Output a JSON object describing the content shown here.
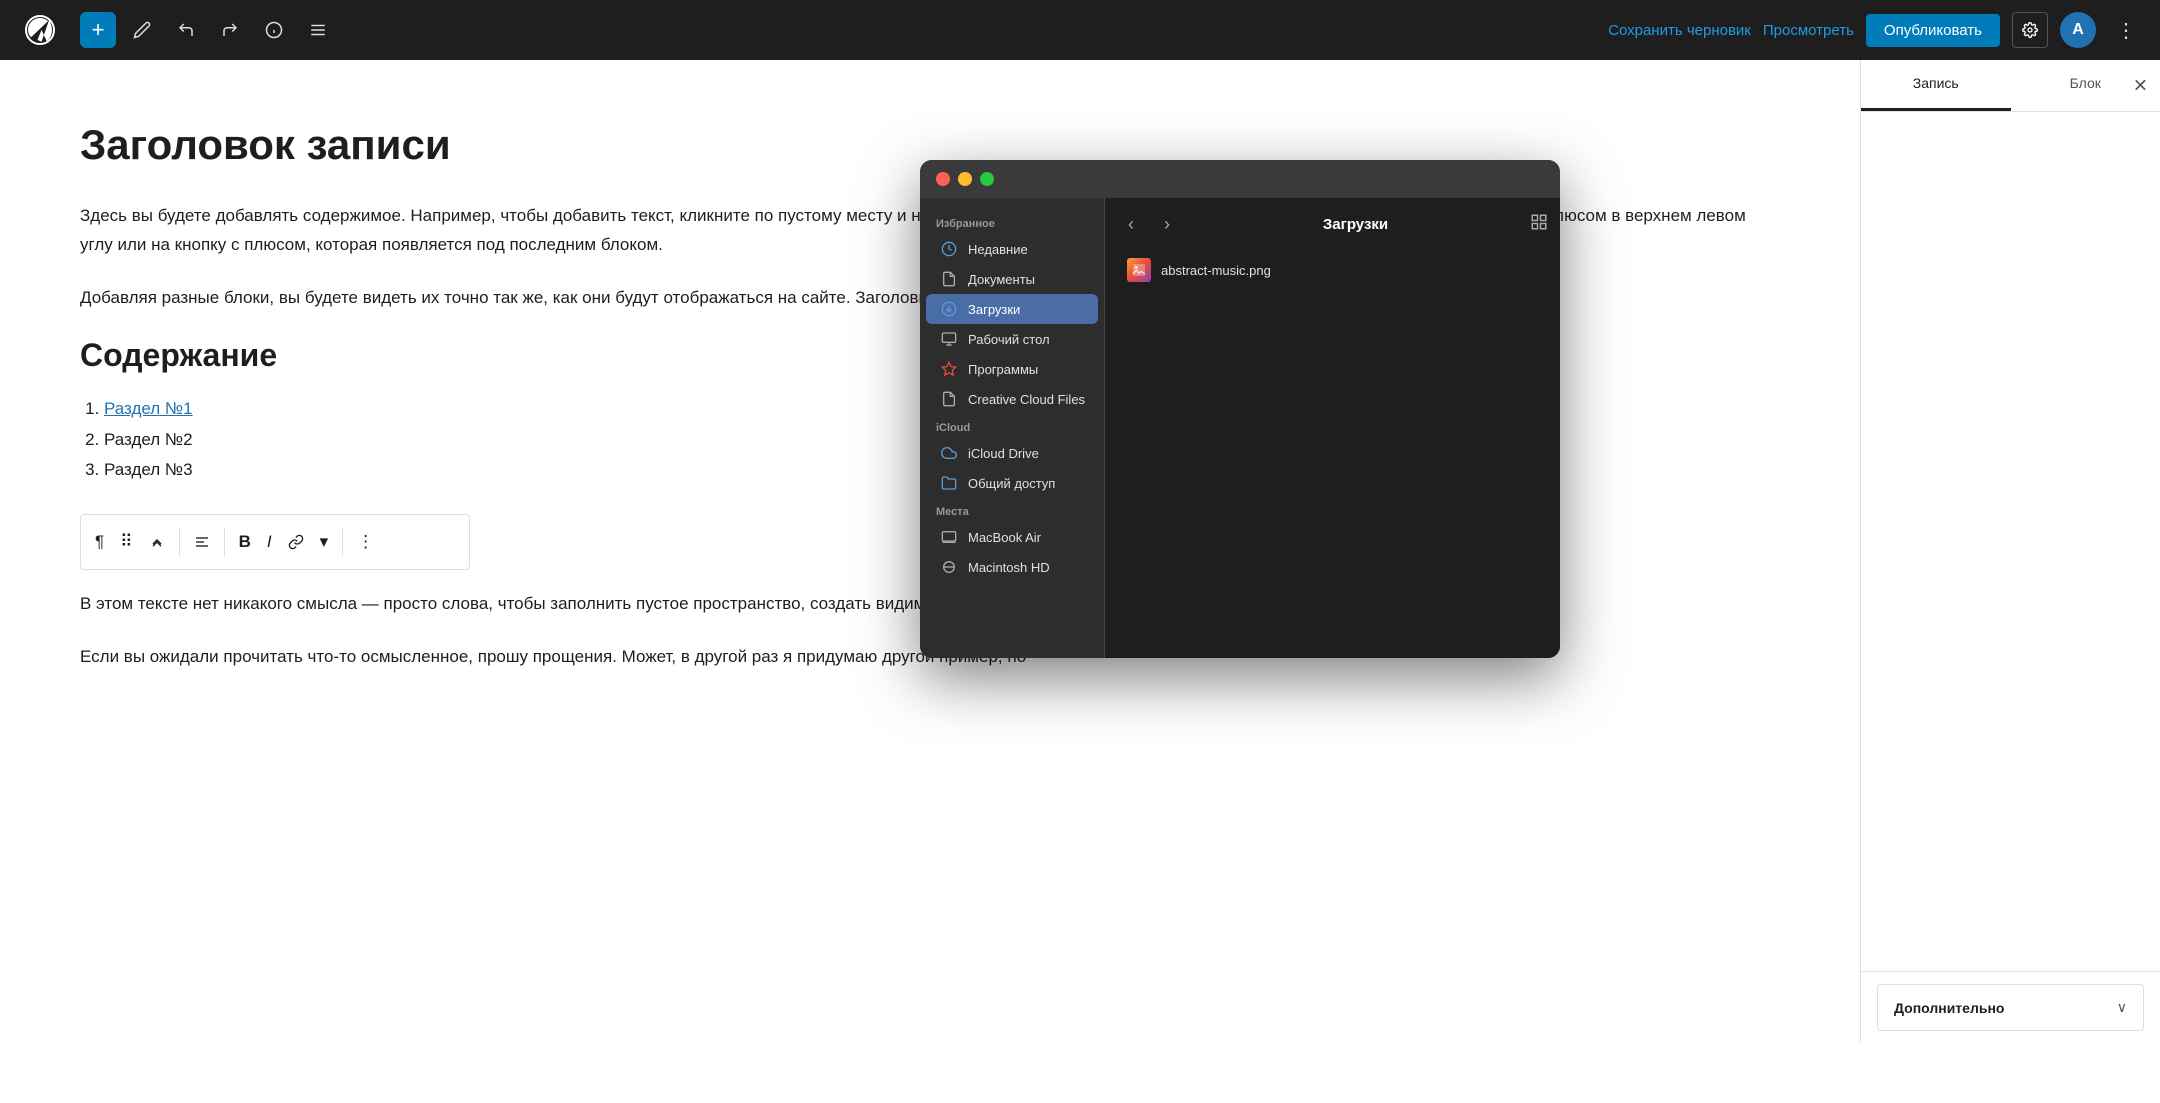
{
  "toolbar": {
    "add_label": "+",
    "save_draft_label": "Сохранить черновик",
    "preview_label": "Просмотреть",
    "publish_label": "Опубликовать"
  },
  "editor": {
    "post_title": "Заголовок записи",
    "paragraph1": "Здесь вы будете добавлять содержимое. Например, чтобы добавить текст, кликните по пустому месту и начните печатать. А чтобы добавить какой-то другой блок, нажмите на кнопку с плюсом в верхнем левом углу или на кнопку с плюсом, которая появляется под последним блоком.",
    "section_heading": "Содержание",
    "toc": [
      {
        "label": "Раздел №1",
        "linked": true
      },
      {
        "label": "Раздел №2",
        "linked": false
      },
      {
        "label": "Раздел №3",
        "linked": false
      }
    ],
    "paragraph2": "Добавляя разные блоки, вы будете видеть их точно так же, как они будут отображаться на сайте. Заголовки, изображения, кнопки — всё будет иметь нужный вид.",
    "paragraph3": "В этом тексте нет никакого смысла — просто слова, чтобы заполнить пустое пространство, создать видимость абзаца.",
    "paragraph4": "Если вы ожидали прочитать что-то осмысленное, прошу прощения. Может, в другой раз я придумаю другой пример, но"
  },
  "sidebar": {
    "tab_record": "Запись",
    "tab_block": "Блок",
    "section_additional": "Дополнительно"
  },
  "file_dialog": {
    "title": "Загрузки",
    "sections": {
      "favorites_label": "Избранное",
      "icloud_label": "iCloud",
      "places_label": "Места"
    },
    "sidebar_items": [
      {
        "id": "recents",
        "label": "Недавние",
        "icon": "🕐",
        "active": false,
        "section": "favorites"
      },
      {
        "id": "documents",
        "label": "Документы",
        "icon": "📄",
        "active": false,
        "section": "favorites"
      },
      {
        "id": "downloads",
        "label": "Загрузки",
        "icon": "⬇",
        "active": true,
        "section": "favorites"
      },
      {
        "id": "desktop",
        "label": "Рабочий стол",
        "icon": "🖥",
        "active": false,
        "section": "favorites"
      },
      {
        "id": "apps",
        "label": "Программы",
        "icon": "🚀",
        "active": false,
        "section": "favorites"
      },
      {
        "id": "creative_cloud",
        "label": "Creative Cloud Files",
        "icon": "📄",
        "active": false,
        "section": "favorites"
      },
      {
        "id": "icloud_drive",
        "label": "iCloud Drive",
        "icon": "☁",
        "active": false,
        "section": "icloud"
      },
      {
        "id": "shared",
        "label": "Общий доступ",
        "icon": "📁",
        "active": false,
        "section": "icloud"
      },
      {
        "id": "macbook",
        "label": "MacBook Air",
        "icon": "💻",
        "active": false,
        "section": "places"
      },
      {
        "id": "macintosh",
        "label": "Macintosh HD",
        "icon": "💿",
        "active": false,
        "section": "places"
      }
    ],
    "files": [
      {
        "name": "abstract-music.png",
        "type": "image"
      }
    ]
  }
}
